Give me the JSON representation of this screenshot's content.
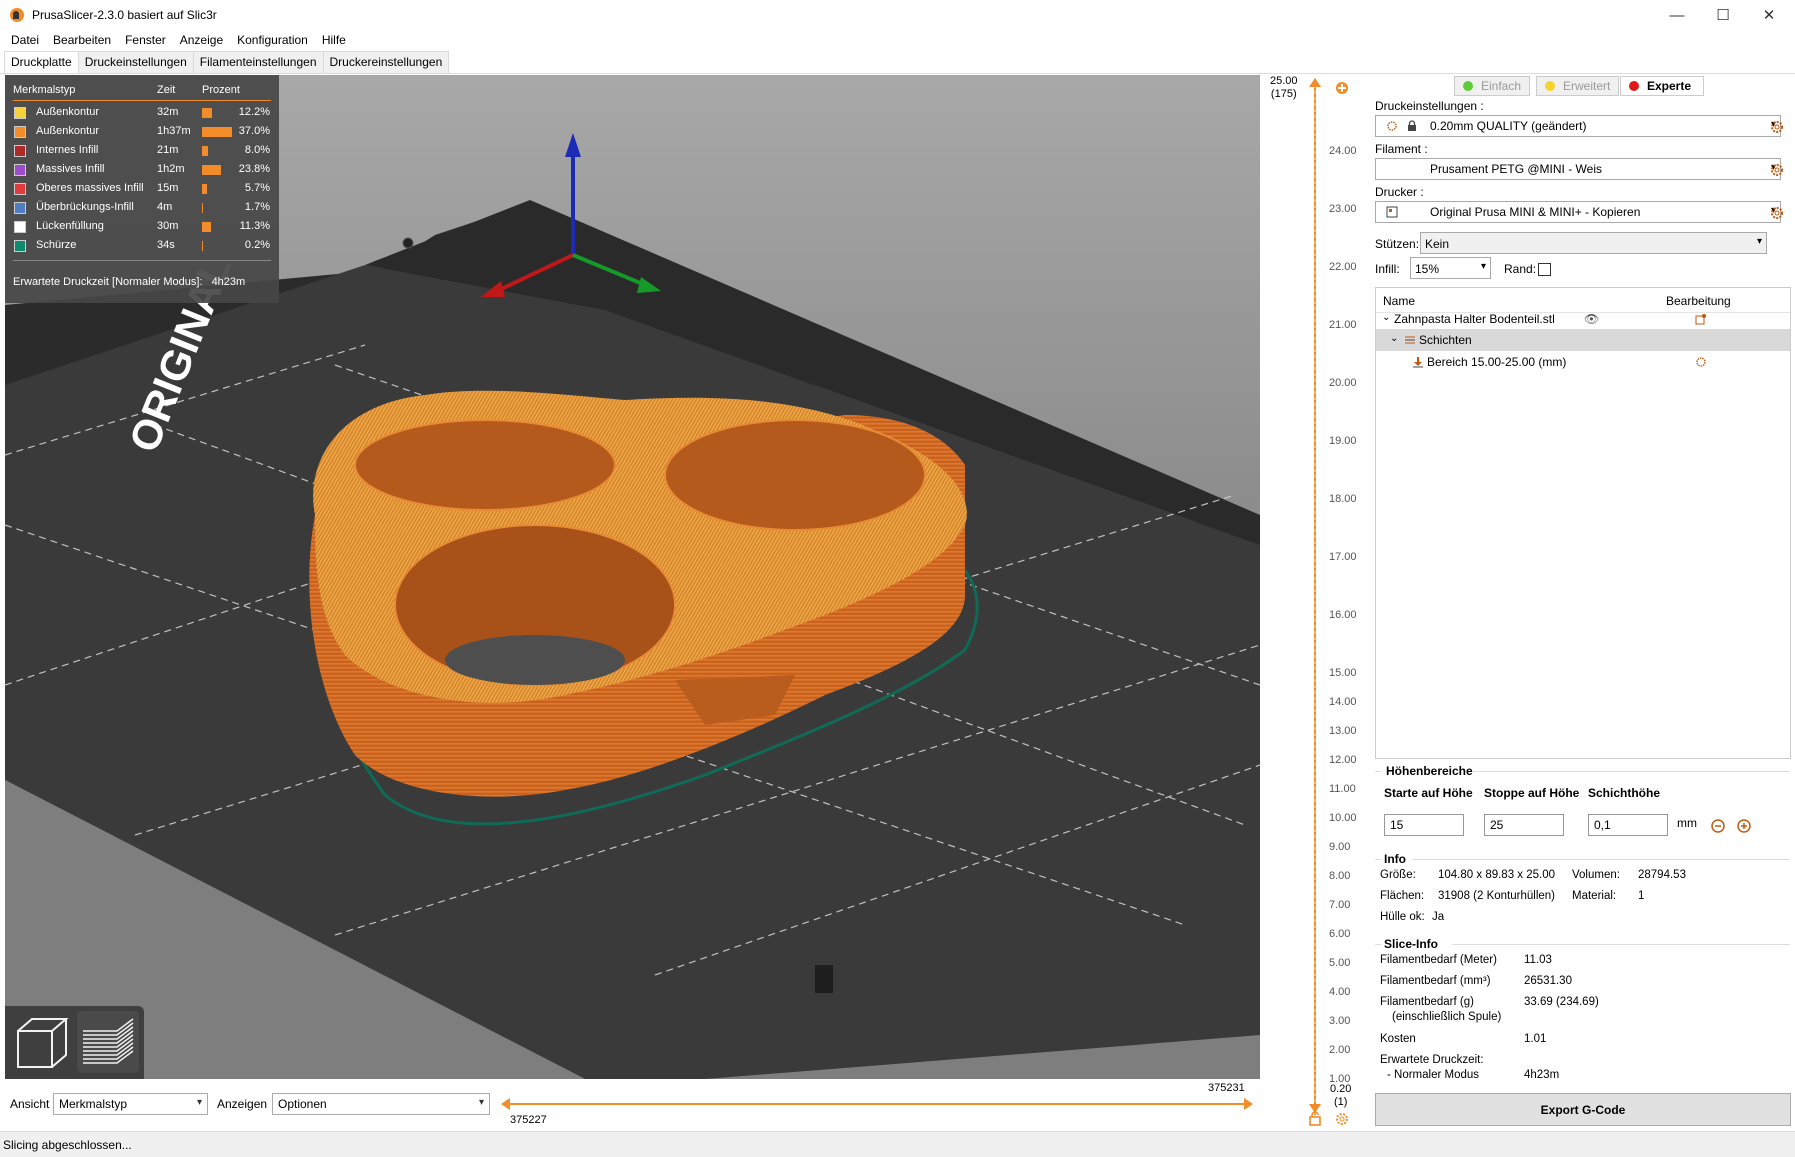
{
  "window": {
    "title": "PrusaSlicer-2.3.0 basiert auf Slic3r",
    "minimize": "—",
    "maximize": "☐",
    "close": "✕"
  },
  "menu": [
    "Datei",
    "Bearbeiten",
    "Fenster",
    "Anzeige",
    "Konfiguration",
    "Hilfe"
  ],
  "tabs": [
    "Druckplatte",
    "Druckeinstellungen",
    "Filamenteinstellungen",
    "Druckereinstellungen"
  ],
  "legend": {
    "col_type": "Merkmalstyp",
    "col_time": "Zeit",
    "col_pct": "Prozent",
    "rows": [
      {
        "name": "Außenkontur",
        "time": "32m",
        "pct": "12.2%",
        "value": 12.2,
        "color": "#f7d13a"
      },
      {
        "name": "Außenkontur",
        "time": "1h37m",
        "pct": "37.0%",
        "value": 37.0,
        "color": "#f28c28"
      },
      {
        "name": "Internes Infill",
        "time": "21m",
        "pct": "8.0%",
        "value": 8.0,
        "color": "#b02a2a"
      },
      {
        "name": "Massives Infill",
        "time": "1h2m",
        "pct": "23.8%",
        "value": 23.8,
        "color": "#9b4dca"
      },
      {
        "name": "Oberes massives Infill",
        "time": "15m",
        "pct": "5.7%",
        "value": 5.7,
        "color": "#e33b3b"
      },
      {
        "name": "Überbrückungs-Infill",
        "time": "4m",
        "pct": "1.7%",
        "value": 1.7,
        "color": "#4f7fc2"
      },
      {
        "name": "Lückenfüllung",
        "time": "30m",
        "pct": "11.3%",
        "value": 11.3,
        "color": "#ffffff"
      },
      {
        "name": "Schürze",
        "time": "34s",
        "pct": "0.2%",
        "value": 0.2,
        "color": "#0f8a70"
      }
    ],
    "footer_label": "Erwartete Druckzeit [Normaler Modus]:",
    "footer_value": "4h23m"
  },
  "bed_text": "ORIGINAL",
  "vslider": {
    "top_value": "25.00",
    "top_layer": "(175)",
    "bottom_value": "0.20",
    "bottom_layer": "(1)",
    "ticks": [
      "24.00",
      "23.00",
      "22.00",
      "21.00",
      "20.00",
      "19.00",
      "18.00",
      "17.00",
      "16.00",
      "15.00",
      "14.00",
      "13.00",
      "12.00",
      "11.00",
      "10.00",
      "9.00",
      "8.00",
      "7.00",
      "6.00",
      "5.00",
      "4.00",
      "3.00",
      "2.00",
      "1.00"
    ]
  },
  "bottom": {
    "ansicht_label": "Ansicht",
    "ansicht_value": "Merkmalstyp",
    "anzeigen_label": "Anzeigen",
    "anzeigen_value": "Optionen",
    "hslider_max": "375231",
    "hslider_min": "375227"
  },
  "status": "Slicing abgeschlossen...",
  "sidebar": {
    "modes": {
      "simple": "Einfach",
      "advanced": "Erweitert",
      "expert": "Experte"
    },
    "print_label": "Druckeinstellungen :",
    "print_value": "0.20mm QUALITY (geändert)",
    "filament_label": "Filament :",
    "filament_value": "Prusament PETG @MINI - Weis",
    "printer_label": "Drucker :",
    "printer_value": "Original Prusa MINI & MINI+ - Kopieren",
    "supports_label": "Stützen:",
    "supports_value": "Kein",
    "infill_label": "Infill:",
    "infill_value": "15%",
    "brim_label": "Rand:",
    "objlist": {
      "col_name": "Name",
      "col_edit": "Bearbeitung",
      "object": "Zahnpasta Halter Bodenteil.stl",
      "layers": "Schichten",
      "range": "Bereich 15.00-25.00 (mm)"
    },
    "height_ranges": {
      "title": "Höhenbereiche",
      "start_label": "Starte auf Höhe",
      "stop_label": "Stoppe auf Höhe",
      "layer_label": "Schichthöhe",
      "start_value": "15",
      "stop_value": "25",
      "layer_value": "0,1",
      "unit": "mm"
    },
    "info": {
      "title": "Info",
      "size_label": "Größe:",
      "size_value": "104.80 x 89.83 x 25.00",
      "volume_label": "Volumen:",
      "volume_value": "28794.53",
      "facets_label": "Flächen:",
      "facets_value": "31908 (2 Konturhüllen)",
      "material_label": "Material:",
      "material_value": "1",
      "manifold_label": "Hülle ok:",
      "manifold_value": "Ja"
    },
    "slice_info": {
      "title": "Slice-Info",
      "fil_m_label": "Filamentbedarf (Meter)",
      "fil_m_value": "11.03",
      "fil_mm3_label": "Filamentbedarf (mm³)",
      "fil_mm3_value": "26531.30",
      "fil_g_label": "Filamentbedarf (g)",
      "fil_g_sub": "(einschließlich Spule)",
      "fil_g_value": "33.69 (234.69)",
      "cost_label": "Kosten",
      "cost_value": "1.01",
      "time_label": "Erwartete Druckzeit:",
      "time_mode": "- Normaler Modus",
      "time_value": "4h23m"
    },
    "export_label": "Export G-Code"
  }
}
